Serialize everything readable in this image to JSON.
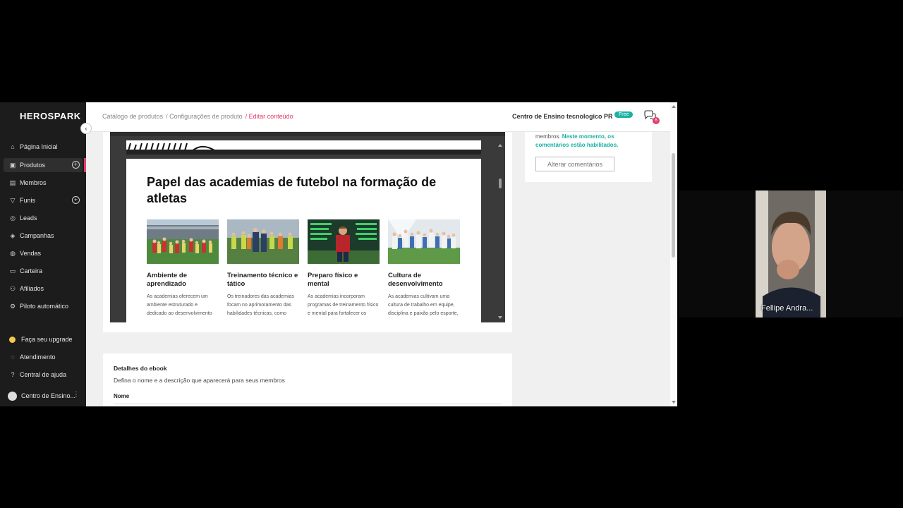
{
  "sidebar": {
    "logo": "HEROSPARK",
    "items": [
      {
        "label": "Página Inicial"
      },
      {
        "label": "Produtos"
      },
      {
        "label": "Membros"
      },
      {
        "label": "Funis"
      },
      {
        "label": "Leads"
      },
      {
        "label": "Campanhas"
      },
      {
        "label": "Vendas"
      },
      {
        "label": "Carteira"
      },
      {
        "label": "Afiliados"
      },
      {
        "label": "Piloto automático"
      }
    ],
    "bottom": [
      {
        "label": "Faça seu upgrade"
      },
      {
        "label": "Atendimento"
      },
      {
        "label": "Central de ajuda"
      }
    ],
    "user": "Centro de Ensino..."
  },
  "header": {
    "breadcrumb": [
      "Catálogo de produtos",
      "/ Configurações de produto",
      "/ Editar conteúdo"
    ],
    "school": "Centro de Ensino tecnologico PR",
    "plan": "Free",
    "chat_count": "6"
  },
  "ebook": {
    "title": "Papel das academias de futebol na formação de atletas",
    "features": [
      {
        "title": "Ambiente de aprendizado",
        "desc": "As academias oferecem um ambiente estruturado e dedicado ao desenvolvimento de jovens"
      },
      {
        "title": "Treinamento técnico e tático",
        "desc": "Os treinadores das academias focam no aprimoramento das habilidades técnicas, como"
      },
      {
        "title": "Preparo físico e mental",
        "desc": "As academias incorporam programas de treinamento físico e mental para fortalecer os atletas e"
      },
      {
        "title": "Cultura de desenvolvimento",
        "desc": "As academias cultivam uma cultura de trabalho em equipe, disciplina e paixão pelo esporte, preparando os"
      }
    ]
  },
  "comments": {
    "text_prefix": "membros.",
    "text_highlight": "Neste momento, os comentários estão habilitados.",
    "button": "Alterar comentários"
  },
  "details": {
    "title": "Detalhes do ebook",
    "subtitle": "Defina o nome e a descrição que aparecerá para seus membros",
    "name_label": "Nome"
  },
  "webcam": {
    "name": "Fellipe Andra..."
  },
  "colors": {
    "accent": "#e23d6b",
    "teal": "#1bb1a3",
    "sidebar": "#1c1c1c"
  }
}
